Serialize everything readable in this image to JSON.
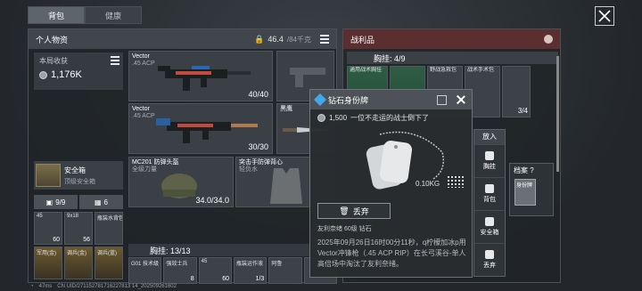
{
  "tabs": [
    {
      "label": "背包"
    },
    {
      "label": "健康"
    }
  ],
  "left": {
    "title": "个人物资",
    "weight_value": "46.4",
    "weight_max": "/84千克",
    "income_label": "本局收获",
    "income_value": "1,176K",
    "safebox_title": "安全箱",
    "safebox_sub": "顶级安全箱",
    "counter_a": "9/9",
    "counter_b": "6",
    "weapon1_name": "Vector",
    "weapon1_sub": ".45 ACP",
    "weapon1_ammo": "40/40",
    "weapon2_name": "Vector",
    "weapon2_sub": ".45 ACP",
    "weapon2_ammo": "30/30",
    "melee_name": "黑鹰",
    "helmet_name": "MC201 防弹头盔",
    "helmet_sub": "全级力量",
    "helmet_dur": "34.0/34.0",
    "armor_name": "突击手防弹背心",
    "armor_sub": "轻负水",
    "chest_label": "胸挂: 13/13",
    "small_items": [
      {
        "tl": "45",
        "br": "60"
      },
      {
        "tl": "9x18",
        "br": "56"
      },
      {
        "tl": "瓶装水背包",
        "br": ""
      },
      {
        "tl": "军用(金)",
        "br": ""
      },
      {
        "tl": "调兵(金)",
        "br": ""
      },
      {
        "tl": "调兵(蓝)",
        "br": ""
      }
    ],
    "chest_items": [
      {
        "tl": "G01 技术级"
      },
      {
        "tl": "强效士兵",
        "br": "8"
      },
      {
        "tl": "45",
        "br": "60"
      },
      {
        "tl": "瓶装运作液",
        "br": "1/3"
      },
      {
        "tl": "阿鲁",
        "br": ""
      },
      {
        "tl": "",
        "br": ""
      }
    ]
  },
  "loot": {
    "title": "战利品",
    "chest_label": "胸挂: 4/9",
    "cells": [
      {
        "tl": "通用战术胸挂"
      },
      {
        "tl": "野战急救包"
      },
      {
        "tl": "战术手术包"
      }
    ],
    "count_label": "3/4"
  },
  "popup": {
    "title": "钻石身份牌",
    "price": "1,500",
    "desc": "一位不走运的战士倒下了",
    "weight": "0.10KG",
    "discard_label": "丢弃",
    "meta": "友利奈绪  60级  钻石",
    "text": "2025年09月26日16时00分11秒，q柠檬加冰p用Vector冲锋枪（.45 ACP RIP）在长弓溪谷-单人高倍场中淘汰了友利奈绪。"
  },
  "putin": {
    "head": "放入",
    "options": [
      {
        "label": "胸挂"
      },
      {
        "label": "背包"
      },
      {
        "label": "安全箱"
      },
      {
        "label": "丢弃"
      }
    ]
  },
  "archive": {
    "title": "档案 ?",
    "slot": "身份牌"
  },
  "status": {
    "fps": "47ms",
    "cn": "CN UID/271152781716227813 14_202509261602"
  },
  "colors": {
    "loot_header": "#5b2f30",
    "accent_blue": "#3fa7ea"
  }
}
